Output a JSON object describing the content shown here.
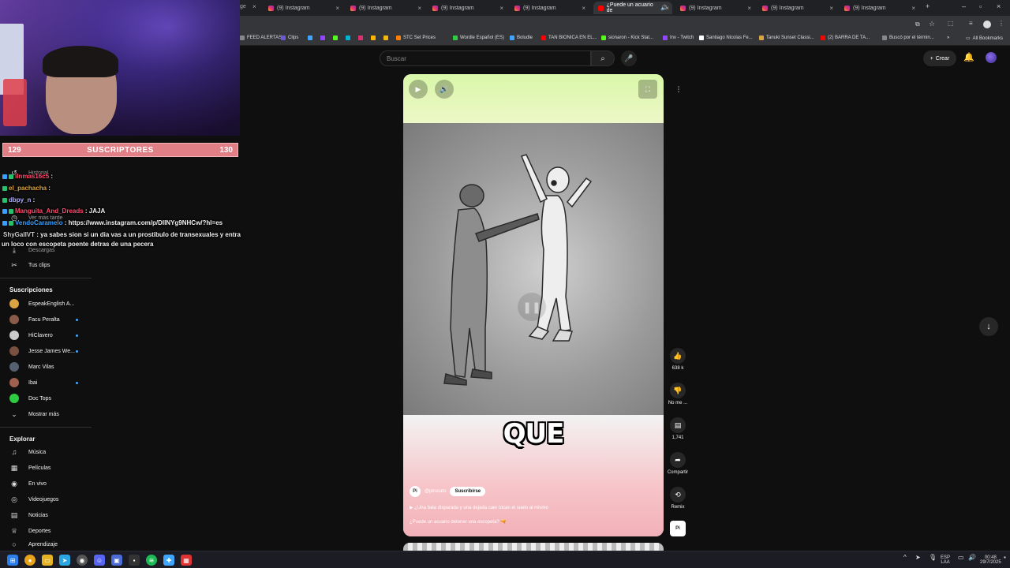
{
  "browser": {
    "tabs": [
      {
        "title": "(9) Instagram",
        "favicon": "instagram-icon"
      },
      {
        "title": "(9) Instagram",
        "favicon": "instagram-icon"
      },
      {
        "title": "(9) Instagram",
        "favicon": "instagram-icon"
      },
      {
        "title": "(9) Instagram",
        "favicon": "instagram-icon"
      },
      {
        "title": "¿Puede un acuario de",
        "favicon": "youtube-icon",
        "active": true
      },
      {
        "title": "(9) Instagram",
        "favicon": "instagram-icon"
      },
      {
        "title": "(9) Instagram",
        "favicon": "instagram-icon"
      },
      {
        "title": "(9) Instagram",
        "favicon": "instagram-icon"
      }
    ],
    "tab_fragment": "ge",
    "new_tab": "+",
    "bookmarks": [
      "FEED ALERTAS",
      "Clips",
      "STC Set Prices",
      "Wordle Español (ES)",
      "Boludle",
      "TAN BIONICA EN EL...",
      "sionaron - Kick Stat...",
      "Inv - Twitch",
      "Santiago Nicolas Fe...",
      "Tanuki Sunset Classi...",
      "(2) BARRA DE TA...",
      "Buscó por el términ..."
    ],
    "all_bookmarks": "All Bookmarks"
  },
  "youtube": {
    "search_placeholder": "Buscar",
    "create_label": "Crear"
  },
  "stream": {
    "subs_left": "129",
    "subs_label": "SUSCRIPTORES",
    "subs_right": "130",
    "chat": [
      {
        "user": "ilnmas16c5",
        "text": " :",
        "color": "#ff4b6e"
      },
      {
        "user": "el_pachacha",
        "text": " :",
        "color": "#d9a441"
      },
      {
        "user": "dbpy_n",
        "text": " :",
        "color": "#b0b0ff"
      },
      {
        "user": "Manguita_And_Dreads",
        "text": " : JAJA",
        "color": "#ff4b6e"
      },
      {
        "user": "VendoCaramelo",
        "text": " : https://www.instagram.com/p/DIINYg9NHCw/?hl=es",
        "color": "#3aa0ff"
      },
      {
        "user": "ShyGallVT",
        "text": " : ya sabes sion si un dia vas a un prostibulo de transexuales y entra",
        "color": "#cfcfcf"
      },
      {
        "user": "",
        "text": "un loco con escopeta poente detras de una pecera",
        "color": "#ffffff"
      }
    ]
  },
  "sidebar": {
    "faded": [
      "Historial",
      "Ver más tarde",
      "Descargas"
    ],
    "tus_clips": "Tus clips",
    "subs_heading": "Suscripciones",
    "subscriptions": [
      {
        "name": "EspeakEnglish A...",
        "color": "#d9a441",
        "live": false
      },
      {
        "name": "Facu Peralta",
        "color": "#8a5a4a",
        "live": true
      },
      {
        "name": "HiClavero",
        "color": "#cccccc",
        "live": true
      },
      {
        "name": "Jesse James We...",
        "color": "#7a5040",
        "live": true
      },
      {
        "name": "Marc Vilas",
        "color": "#556070",
        "live": false
      },
      {
        "name": "Ibai",
        "color": "#a06050",
        "live": true
      },
      {
        "name": "Doc Tops",
        "color": "#2ecc40",
        "live": false
      }
    ],
    "show_more": "Mostrar más",
    "explore_heading": "Explorar",
    "explore": [
      {
        "label": "Música",
        "icon": "music-note-icon",
        "glyph": "♫"
      },
      {
        "label": "Películas",
        "icon": "film-icon",
        "glyph": "▦"
      },
      {
        "label": "En vivo",
        "icon": "live-icon",
        "glyph": "◉"
      },
      {
        "label": "Videojuegos",
        "icon": "gamepad-icon",
        "glyph": "◎"
      },
      {
        "label": "Noticias",
        "icon": "news-icon",
        "glyph": "▤"
      },
      {
        "label": "Deportes",
        "icon": "trophy-icon",
        "glyph": "♕"
      },
      {
        "label": "Aprendizaje",
        "icon": "lightbulb-icon",
        "glyph": "○"
      }
    ]
  },
  "short": {
    "caption": "QUE",
    "channel": "@pirucato",
    "channel_avatar": "Pi",
    "subscribe": "Suscribirse",
    "description": "¿Una bala disparada y una dejada caer tocan el suelo al mismo",
    "title": "¿Puede un acuario detener una escopeta? 🔫"
  },
  "actions": {
    "likes": "638 k",
    "dislike": "No me ...",
    "comments": "1,741",
    "share": "Compartir",
    "remix": "Remix",
    "sound_avatar": "Pi"
  },
  "taskbar": {
    "lang_top": "ESP",
    "lang_bottom": "LAA",
    "time": "00:48",
    "date": "29/7/2025"
  }
}
